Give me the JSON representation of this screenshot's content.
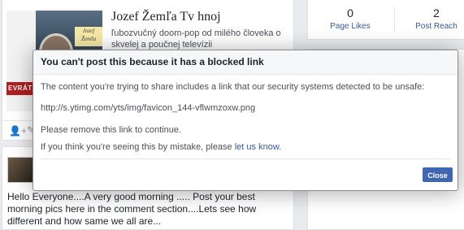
{
  "share_preview": {
    "title": "Jozef Žemľa Tv hnoj",
    "description": "ľubozvučný doom-pop od milého človeka o skvelej a poučnej televízii",
    "thumb_label_line1": "Jozef",
    "thumb_label_line2": "Žemľa",
    "thumb_banner": "EVRÁTEN"
  },
  "post": {
    "text": "Hello Everyone....A very good morning ..... Post your best morning pics here in the comment section....Lets see how different and how same we all are..."
  },
  "stats": {
    "likes_value": "0",
    "likes_label": "Page Likes",
    "reach_value": "2",
    "reach_label": "Post Reach"
  },
  "dialog": {
    "title": "You can't post this because it has a blocked link",
    "message": "The content you're trying to share includes a link that our security systems detected to be unsafe:",
    "blocked_url": "http://s.ytimg.com/yts/img/favicon_144-vflwmzoxw.png",
    "instruction": "Please remove this link to continue.",
    "mistake_prefix": "If you think you're seeing this by mistake, please ",
    "mistake_link": "let us know",
    "mistake_suffix": ".",
    "close_label": "Close",
    "accent_color": "#4267b2"
  }
}
